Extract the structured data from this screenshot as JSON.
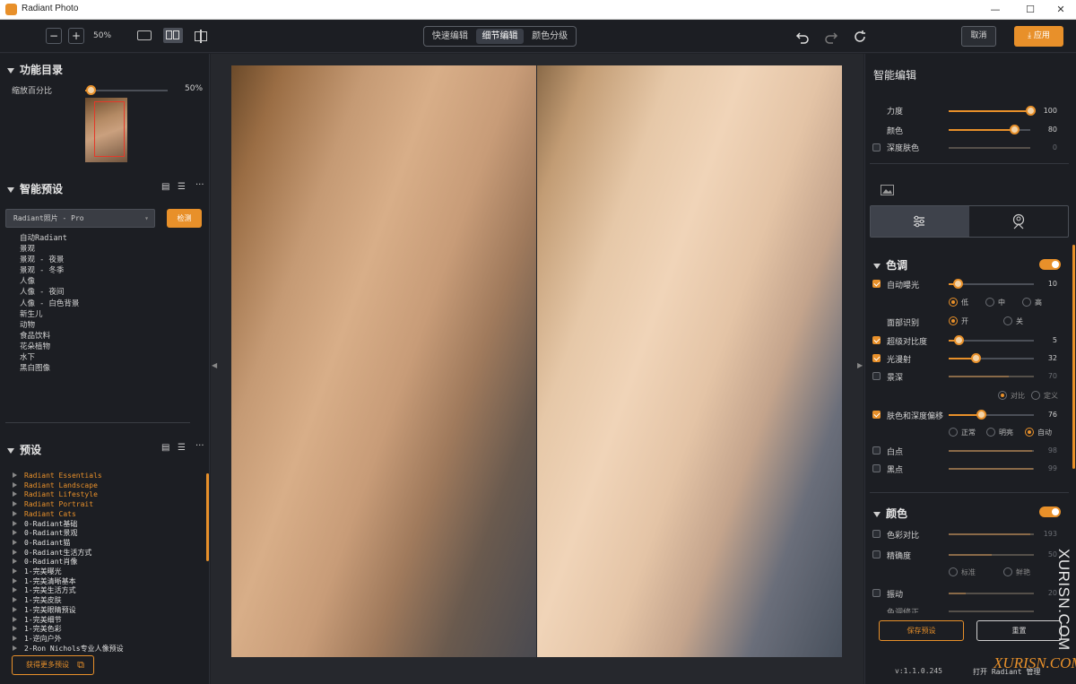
{
  "window": {
    "title": "Radiant Photo",
    "minimize": "—",
    "maximize": "☐",
    "close": "✕"
  },
  "toolbar": {
    "zoom_out": "−",
    "zoom_in": "+",
    "zoom_value": "50%",
    "modes": [
      "快速编辑",
      "细节编辑",
      "颜色分级"
    ],
    "active_mode": "细节编辑",
    "cancel_label": "取消",
    "apply_label": "应用"
  },
  "left": {
    "catalog_title": "功能目录",
    "zoom_label": "缩放百分比",
    "zoom_value": "50%",
    "zoom_fraction": 0.06,
    "smart_title": "智能预设",
    "preset_select": "Radiant照片 - Pro",
    "detect_label": "检测",
    "smart_items": [
      "自动Radiant",
      "景观",
      "景观 - 夜景",
      "景观 - 冬季",
      "人像",
      "人像 - 夜间",
      "人像 - 白色背景",
      "新生儿",
      "动物",
      "食品饮料",
      "花朵植物",
      "水下",
      "黑白图像"
    ],
    "presets_title": "预设",
    "presets": [
      {
        "label": "Radiant Essentials",
        "highlight": true
      },
      {
        "label": "Radiant Landscape",
        "highlight": true
      },
      {
        "label": "Radiant Lifestyle",
        "highlight": true
      },
      {
        "label": "Radiant Portrait",
        "highlight": true
      },
      {
        "label": "Radiant Cats",
        "highlight": true
      },
      {
        "label": "0-Radiant基础",
        "highlight": false
      },
      {
        "label": "0-Radiant景观",
        "highlight": false
      },
      {
        "label": "0-Radiant猫",
        "highlight": false
      },
      {
        "label": "0-Radiant生活方式",
        "highlight": false
      },
      {
        "label": "0-Radiant肖像",
        "highlight": false
      },
      {
        "label": "1-完美曝光",
        "highlight": false
      },
      {
        "label": "1-完美清晰基本",
        "highlight": false
      },
      {
        "label": "1-完美生活方式",
        "highlight": false
      },
      {
        "label": "1-完美皮肤",
        "highlight": false
      },
      {
        "label": "1-完美眼睛预设",
        "highlight": false
      },
      {
        "label": "1-完美细节",
        "highlight": false
      },
      {
        "label": "1-完美色彩",
        "highlight": false
      },
      {
        "label": "1-逆向户外",
        "highlight": false
      },
      {
        "label": "2-Ron Nichols专业人像预设",
        "highlight": false
      }
    ],
    "more_label": "获得更多预设"
  },
  "right": {
    "title": "智能编辑",
    "smart": [
      {
        "label": "力度",
        "value": "100",
        "fraction": 1.0
      },
      {
        "label": "颜色",
        "value": "80",
        "fraction": 0.8
      },
      {
        "label": "深度肤色",
        "value": "0",
        "fraction": 0.0
      }
    ],
    "tone_title": "色调",
    "auto_exposure": {
      "label": "自动曝光",
      "value": "10",
      "fraction": 0.1
    },
    "exposure_opts": [
      "低",
      "中",
      "高"
    ],
    "face_label": "面部识别",
    "face_opts": [
      "开",
      "关"
    ],
    "super_contrast": {
      "label": "超级对比度",
      "value": "5",
      "fraction": 0.12
    },
    "light_diffusion": {
      "label": "光漫射",
      "value": "32",
      "fraction": 0.32
    },
    "depth": {
      "label": "景深",
      "value": "70",
      "fraction": 0.7
    },
    "depth_opts": [
      "对比",
      "定义"
    ],
    "skin_depth": {
      "label": "肤色和深度偏移",
      "value": "76",
      "fraction": 0.38
    },
    "skin_opts": [
      "正常",
      "明亮",
      "自动"
    ],
    "white_point": {
      "label": "白点",
      "value": "98",
      "fraction": 0.98
    },
    "black_point": {
      "label": "黑点",
      "value": "99",
      "fraction": 0.99
    },
    "color_title": "颜色",
    "color_contrast": {
      "label": "色彩对比",
      "value": "193",
      "fraction": 0.96
    },
    "precision": {
      "label": "精确度",
      "value": "50",
      "fraction": 0.5
    },
    "precision_opts": [
      "标准",
      "鲜艳"
    ],
    "vibrance": {
      "label": "振动",
      "value": "20",
      "fraction": 0.2
    },
    "partial": {
      "label": "色调修正"
    },
    "save_label": "保存预设",
    "reset_label": "重置",
    "version": "v:1.1.0.245",
    "open_manager": "打开 Radiant 管理"
  },
  "watermark": {
    "vertical": "XURISN.COM",
    "horizontal": "XURISN.COM"
  },
  "colors": {
    "accent": "#e8902a",
    "panel": "#1c1e23",
    "canvas": "#26282d"
  }
}
